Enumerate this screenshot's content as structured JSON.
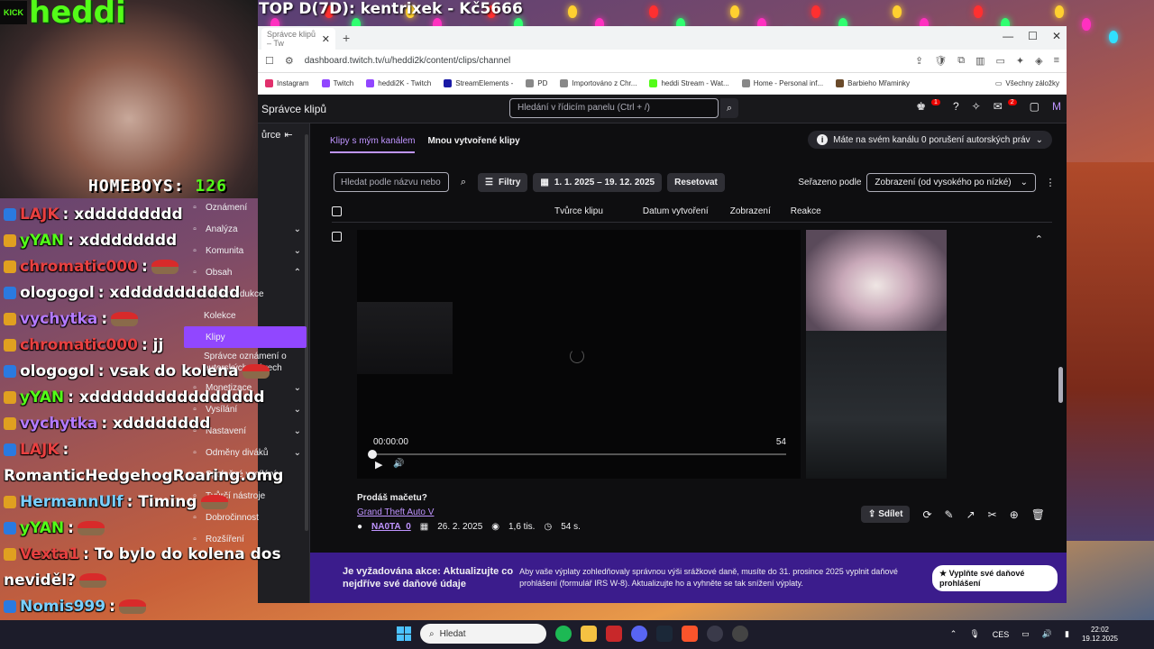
{
  "overlay": {
    "top_text": "TOP D(7D): kentrixek - Kč5666",
    "kick_tag": "KICK",
    "streamer": "heddi",
    "homeboys_label": "HOMEBOYS:",
    "homeboys_count": "126"
  },
  "browser": {
    "tab_title": "Správce klipů – Tw",
    "url": "dashboard.twitch.tv/u/heddi2k/content/clips/channel",
    "bookmarks": [
      {
        "label": "Instagram",
        "color": "#e1306c"
      },
      {
        "label": "Twitch",
        "color": "#9146ff"
      },
      {
        "label": "heddi2K - Twitch",
        "color": "#9146ff"
      },
      {
        "label": "StreamElements -",
        "color": "#1a1aa6"
      },
      {
        "label": "PD",
        "color": "#888888"
      },
      {
        "label": "Importováno z Chr...",
        "color": "#888888"
      },
      {
        "label": "heddi Stream - Wat...",
        "color": "#53fc18"
      },
      {
        "label": "Home - Personal inf...",
        "color": "#888888"
      },
      {
        "label": "Barbieho Mřaminky",
        "color": "#6a4a2a"
      }
    ],
    "all_bookmarks": "Všechny záložky"
  },
  "dashboard": {
    "title": "Správce klipů",
    "search_placeholder": "Hledání v řídicím panelu (Ctrl + /)",
    "sidebar_top": "ůrce",
    "sidebar_o": "o",
    "sidebar_ni": "ní",
    "tabs": {
      "active": "Klipy s mým kanálem",
      "other": "Mnou vytvořené klipy"
    },
    "copyright_notice": "Máte na svém kanálu 0 porušení autorských práv",
    "filter_placeholder": "Hledat podle názvu nebo",
    "filters_btn": "Filtry",
    "date_range": "1. 1. 2025 – 19. 12. 2025",
    "reset_btn": "Resetovat",
    "sort_label": "Seřazeno podle",
    "sort_value": "Zobrazení (od vysokého po nízké)",
    "columns": [
      "Tvůrce klipu",
      "Datum vytvoření",
      "Zobrazení",
      "Reakce"
    ],
    "clip": {
      "time": "00:00:00",
      "duration": "54",
      "title": "Prodáš mačetu?",
      "game": "Grand Theft Auto V",
      "creator": "NA0TA_0",
      "date": "26. 2. 2025",
      "views": "1,6 tis.",
      "length": "54 s.",
      "share": "Sdílet"
    },
    "banner": {
      "title": "Je vyžadována akce: Aktualizujte co nejdříve své daňové údaje",
      "text": "Aby vaše výplaty zohledňovaly správnou výši srážkové daně, musíte do 31. prosince 2025 vyplnit daňové prohlášení (formulář IRS W-8). Aktualizujte ho a vyhněte se tak snížení výplaty.",
      "button": "Vyplňte své daňové prohlášení"
    }
  },
  "nav": [
    {
      "label": "Oznámení",
      "icon": "megaphone-icon",
      "chev": ""
    },
    {
      "label": "Analýza",
      "icon": "chart-icon",
      "chev": "⌄"
    },
    {
      "label": "Komunita",
      "icon": "community-icon",
      "chev": "⌄"
    },
    {
      "label": "Obsah",
      "icon": "content-icon",
      "chev": "⌃"
    },
    {
      "label": "Videoprodukce",
      "icon": "",
      "chev": ""
    },
    {
      "label": "Kolekce",
      "icon": "",
      "chev": ""
    },
    {
      "label": "Klipy",
      "icon": "",
      "chev": ""
    },
    {
      "label": "Správce oznámení o autorských právech",
      "icon": "",
      "chev": ""
    },
    {
      "label": "Monetizace",
      "icon": "monetization-icon",
      "chev": "⌄"
    },
    {
      "label": "Vysílání",
      "icon": "broadcast-icon",
      "chev": "⌄"
    },
    {
      "label": "Nastavení",
      "icon": "settings-icon",
      "chev": "⌄"
    },
    {
      "label": "Odměny diváků",
      "icon": "rewards-icon",
      "chev": "⌄"
    },
    {
      "label": "Společné vysílání",
      "icon": "collab-icon",
      "chev": ""
    },
    {
      "label": "Tvůrčí nástroje",
      "icon": "tools-icon",
      "chev": ""
    },
    {
      "label": "Dobročinnost",
      "icon": "charity-icon",
      "chev": ""
    },
    {
      "label": "Rozšíření",
      "icon": "extensions-icon",
      "chev": ""
    }
  ],
  "chat": [
    {
      "user": "LAJK",
      "color": "#e84040",
      "msg": ": xddddddddd"
    },
    {
      "user": "yYAN",
      "color": "#53fc18",
      "msg": ": xdddddddd"
    },
    {
      "user": "chromatic000",
      "color": "#e84040",
      "msg": ":"
    },
    {
      "user": "ologogol",
      "color": "#ffffff",
      "msg": ": xddddddddddd"
    },
    {
      "user": "vychytka",
      "color": "#b47aff",
      "msg": ":"
    },
    {
      "user": "chromatic000",
      "color": "#e84040",
      "msg": ": jj"
    },
    {
      "user": "ologogol",
      "color": "#ffffff",
      "msg": ": vsak do kolena"
    },
    {
      "user": "yYAN",
      "color": "#53fc18",
      "msg": ": xdddddddddddddddd"
    },
    {
      "user": "vychytka",
      "color": "#b47aff",
      "msg": ": xdddddddd"
    },
    {
      "user": "LAJK",
      "color": "#e84040",
      "msg": ":"
    },
    {
      "user": "",
      "color": "#ffffff",
      "msg": "RomanticHedgehogRoaring.omg"
    },
    {
      "user": "HermannUlf",
      "color": "#7ad0ff",
      "msg": ": Timing"
    },
    {
      "user": "yYAN",
      "color": "#53fc18",
      "msg": ":"
    },
    {
      "user": "Vexta1",
      "color": "#e84040",
      "msg": ": To bylo do kolena dos"
    },
    {
      "user": "",
      "color": "#ffffff",
      "msg": "neviděl?"
    },
    {
      "user": "Nomis999",
      "color": "#7ad0ff",
      "msg": ":"
    }
  ],
  "taskbar": {
    "search": "Hledat",
    "lang": "CES",
    "time": "22:02",
    "date": "19.12.2025"
  }
}
